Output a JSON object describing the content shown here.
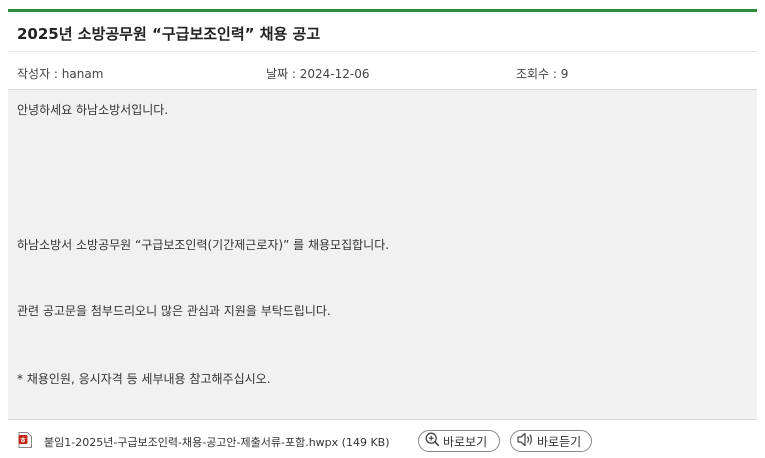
{
  "post": {
    "title": "2025년 소방공무원 “구급보조인력” 채용 공고",
    "author_label": "작성자 : hanam",
    "date_label": "날짜 : 2024-12-06",
    "views_label": "조회수 : 9"
  },
  "content": {
    "line1": "안녕하세요 하남소방서입니다.",
    "line2": "하남소방서 소방공무원 “구급보조인력(기간제근로자)” 를 채용모집합니다.",
    "line3": "관련 공고문을 첨부드리오니 많은 관심과 지원을 부탁드립니다.",
    "line4": "* 채용인원, 응시자격 등 세부내용 참고해주십시오."
  },
  "attachment": {
    "file_icon": "hwp-file-icon",
    "file_name": "붙임1-2025년-구급보조인력-채용-공고안-제출서류-포함.hwpx (149 KB)",
    "view_button": "바로보기",
    "listen_button": "바로듣기"
  },
  "colors": {
    "accent_green": "#2e8b3a",
    "content_bg": "#f1f1f1",
    "file_icon_red": "#c0281c"
  }
}
